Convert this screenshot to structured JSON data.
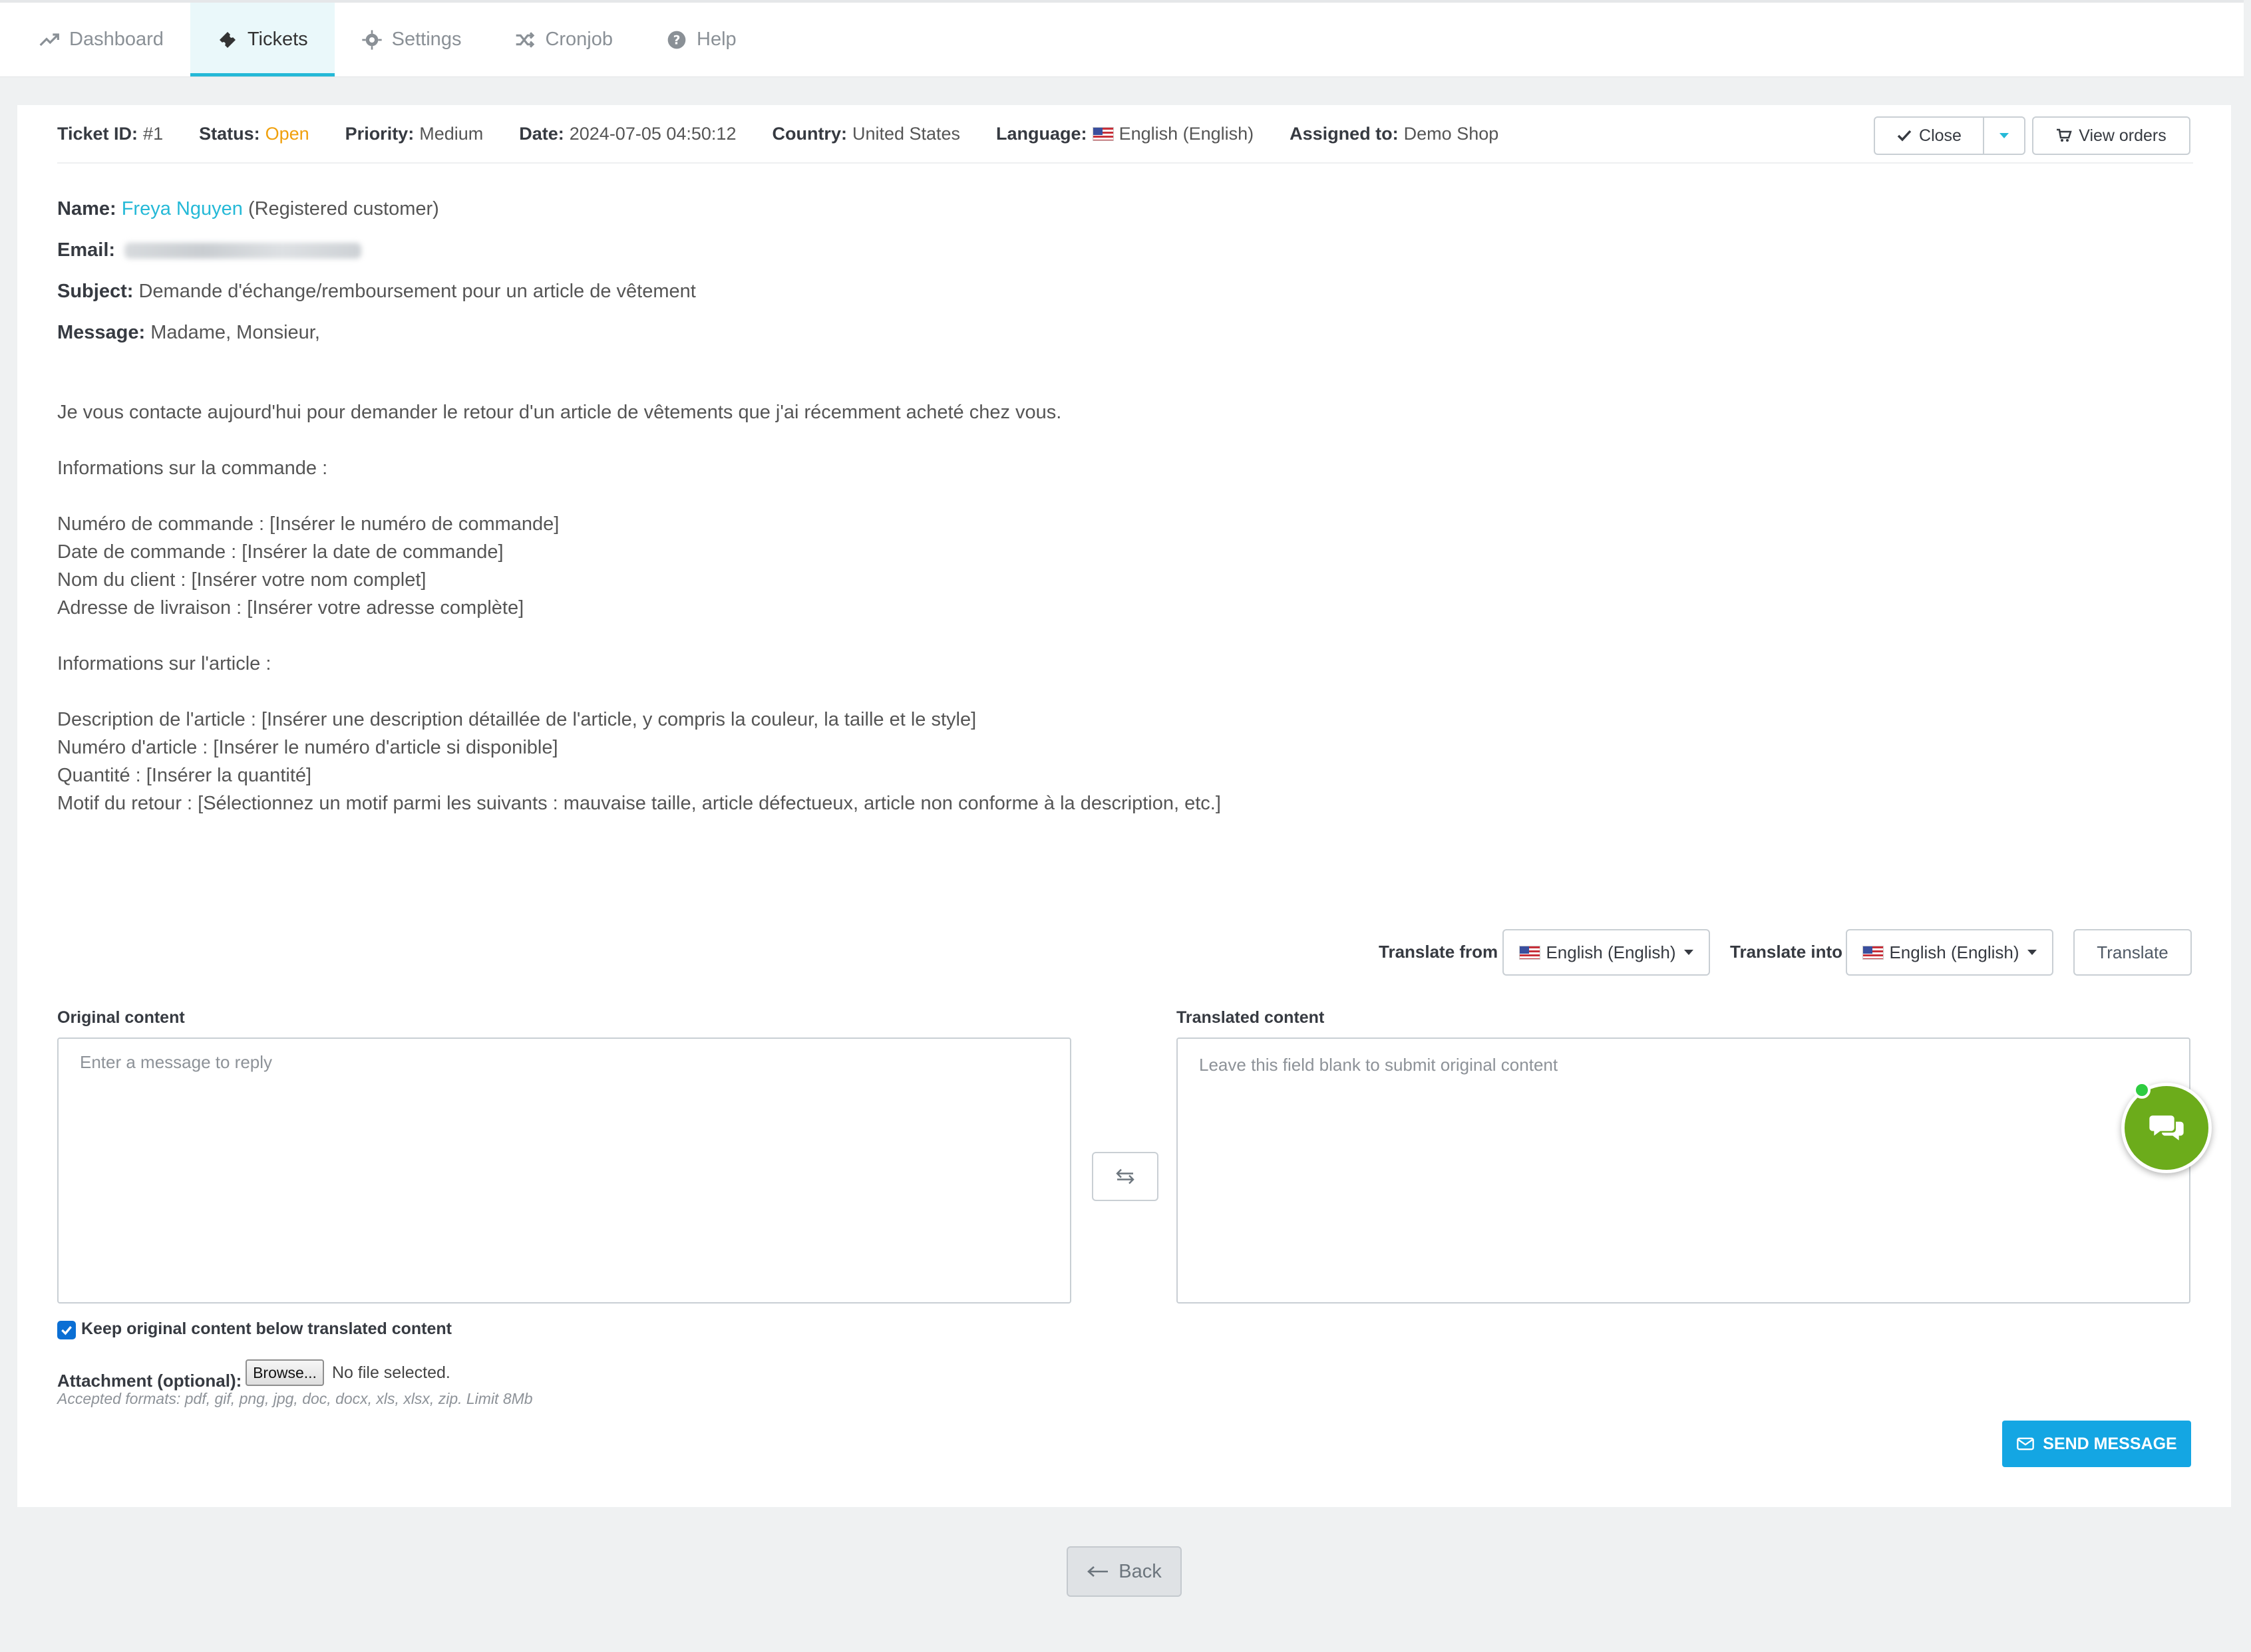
{
  "nav": {
    "tabs": [
      {
        "label": "Dashboard",
        "icon": "trending-up-icon",
        "active": false
      },
      {
        "label": "Tickets",
        "icon": "ticket-icon",
        "active": true
      },
      {
        "label": "Settings",
        "icon": "gear-icon",
        "active": false
      },
      {
        "label": "Cronjob",
        "icon": "shuffle-icon",
        "active": false
      },
      {
        "label": "Help",
        "icon": "question-circle-icon",
        "active": false
      }
    ]
  },
  "ticket": {
    "id_label": "Ticket ID:",
    "id_value": "#1",
    "status_label": "Status:",
    "status_value": "Open",
    "priority_label": "Priority:",
    "priority_value": "Medium",
    "date_label": "Date:",
    "date_value": "2024-07-05 04:50:12",
    "country_label": "Country:",
    "country_value": "United States",
    "language_label": "Language:",
    "language_value": "English (English)",
    "assigned_label": "Assigned to:",
    "assigned_value": "Demo Shop",
    "close_label": "Close",
    "view_orders_label": "View orders",
    "status_color": "#f0a00c"
  },
  "customer": {
    "name_label": "Name:",
    "name_value": "Freya Nguyen",
    "name_suffix": "(Registered customer)",
    "email_label": "Email:",
    "subject_label": "Subject:",
    "subject_value": "Demande d'échange/remboursement pour un article de vêtement",
    "message_label": "Message:",
    "message_first_line": "Madame, Monsieur,",
    "message_body": "\nJe vous contacte aujourd'hui pour demander le retour d'un article de vêtements que j'ai récemment acheté chez vous.\n\nInformations sur la commande :\n\nNuméro de commande : [Insérer le numéro de commande]\nDate de commande : [Insérer la date de commande]\nNom du client : [Insérer votre nom complet]\nAdresse de livraison : [Insérer votre adresse complète]\n\nInformations sur l'article :\n\nDescription de l'article : [Insérer une description détaillée de l'article, y compris la couleur, la taille et le style]\nNuméro d'article : [Insérer le numéro d'article si disponible]\nQuantité : [Insérer la quantité]\nMotif du retour : [Sélectionnez un motif parmi les suivants : mauvaise taille, article défectueux, article non conforme à la description, etc.]"
  },
  "translate": {
    "from_label": "Translate from",
    "from_value": "English (English)",
    "into_label": "Translate into",
    "into_value": "English (English)",
    "button_label": "Translate"
  },
  "reply": {
    "original_label": "Original content",
    "original_placeholder": "Enter a message to reply",
    "translated_label": "Translated content",
    "translated_placeholder": "Leave this field blank to submit original content",
    "keep_original_label": "Keep original content below translated content",
    "keep_original_checked": true,
    "attachment_label": "Attachment (optional):",
    "browse_label": "Browse...",
    "no_file_label": "No file selected.",
    "formats_hint": "Accepted formats: pdf, gif, png, jpg, doc, docx, xls, xlsx, zip. Limit 8Mb",
    "send_label": "SEND MESSAGE"
  },
  "footer": {
    "back_label": "Back"
  },
  "colors": {
    "accent": "#25b9d7",
    "send_button": "#14a6e3",
    "chat_bubble": "#6cac1b"
  }
}
